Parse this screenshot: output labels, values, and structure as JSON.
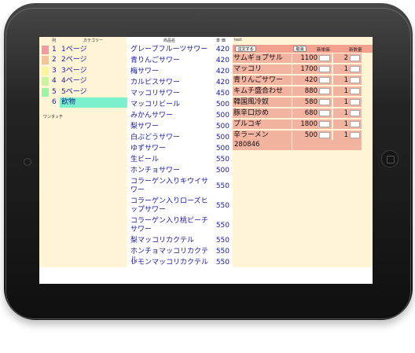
{
  "category_header": {
    "col_no": "列",
    "col_name": "カテゴリー"
  },
  "categories": [
    {
      "no": "1",
      "label": "1ページ",
      "color": "#f59aa0"
    },
    {
      "no": "2",
      "label": "2ページ",
      "color": "#f5c39a"
    },
    {
      "no": "3",
      "label": "3ページ",
      "color": "#f8f59a"
    },
    {
      "no": "4",
      "label": "4ページ",
      "color": "#c8f59a"
    },
    {
      "no": "5",
      "label": "5ページ",
      "color": "#9af5a6"
    },
    {
      "no": "6",
      "label": "飲物",
      "color": "#7cf0cc"
    }
  ],
  "onetouch_label": "ワンタッチ",
  "product_header": {
    "name": "商品名",
    "price": "単 価"
  },
  "products": [
    {
      "name": "グレープフルーツサワー",
      "price": "420"
    },
    {
      "name": "青りんごサワー",
      "price": "420"
    },
    {
      "name": "梅サワー",
      "price": "420"
    },
    {
      "name": "カルピスサワー",
      "price": "420"
    },
    {
      "name": "マッコリサワー",
      "price": "450"
    },
    {
      "name": "マッコリビール",
      "price": "500"
    },
    {
      "name": "みかんサワー",
      "price": "500"
    },
    {
      "name": "梨サワー",
      "price": "500"
    },
    {
      "name": "白ぶどうサワー",
      "price": "500"
    },
    {
      "name": "ゆずサワー",
      "price": "500"
    },
    {
      "name": "生ビール",
      "price": "550"
    },
    {
      "name": "ホンチョサワー",
      "price": "500"
    },
    {
      "name": "コラーゲン入りキウイサワー",
      "price": "550"
    },
    {
      "name": "コラーゲン入りローズヒップサワー",
      "price": "550"
    },
    {
      "name": "コラーゲン入り桃ピーチサワー",
      "price": "550"
    },
    {
      "name": "梨マッコリカクテル",
      "price": "550"
    },
    {
      "name": "ホンチョマッコリカクテル",
      "price": "550"
    },
    {
      "name": "レモンマッコリカクテル",
      "price": "550"
    }
  ],
  "order": {
    "title": "test",
    "order_button": "注文する",
    "cancel_button": "取消",
    "new_price_label": "新単価",
    "new_qty_label": "新数量",
    "items": [
      {
        "name": "サムギョプサル",
        "price": "1100",
        "qty": "2"
      },
      {
        "name": "マッコリ",
        "price": "1700",
        "qty": "1"
      },
      {
        "name": "青りんごサワー",
        "price": "420",
        "qty": "1"
      },
      {
        "name": "キムチ盛合わせ",
        "price": "880",
        "qty": "1"
      },
      {
        "name": "韓国風冷奴",
        "price": "580",
        "qty": "1"
      },
      {
        "name": "豚辛口炒め",
        "price": "680",
        "qty": "1"
      },
      {
        "name": "プルコギ",
        "price": "1800",
        "qty": "1"
      },
      {
        "name": "辛ラーメン",
        "price": "500",
        "qty": "1"
      }
    ],
    "total": "280846"
  }
}
